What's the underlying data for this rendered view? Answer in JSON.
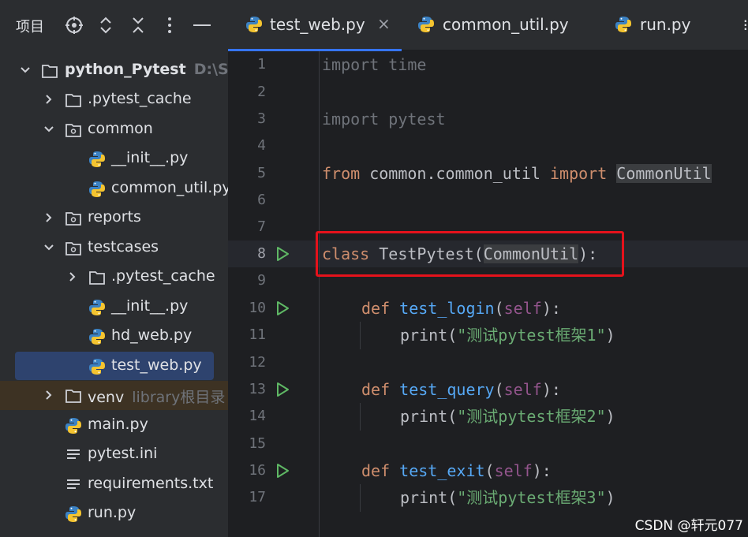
{
  "project_panel": {
    "title": "项目",
    "tree": [
      {
        "label": "python_Pytest",
        "hint": "D:\\Sof",
        "type": "root-folder",
        "expanded": true
      },
      {
        "label": ".pytest_cache",
        "type": "folder",
        "expanded": false
      },
      {
        "label": "common",
        "type": "package",
        "expanded": true
      },
      {
        "label": "__init__.py",
        "type": "python-file"
      },
      {
        "label": "common_util.py",
        "type": "python-file"
      },
      {
        "label": "reports",
        "type": "package",
        "expanded": false
      },
      {
        "label": "testcases",
        "type": "package",
        "expanded": true
      },
      {
        "label": ".pytest_cache",
        "type": "folder",
        "expanded": false
      },
      {
        "label": "__init__.py",
        "type": "python-file"
      },
      {
        "label": "hd_web.py",
        "type": "python-file"
      },
      {
        "label": "test_web.py",
        "type": "python-file",
        "selected": true
      },
      {
        "label": "venv",
        "hint": "library根目录",
        "type": "folder",
        "expanded": false
      },
      {
        "label": "main.py",
        "type": "python-file"
      },
      {
        "label": "pytest.ini",
        "type": "text-file"
      },
      {
        "label": "requirements.txt",
        "type": "text-file"
      },
      {
        "label": "run.py",
        "type": "python-file"
      }
    ]
  },
  "tabs": [
    {
      "label": "test_web.py",
      "active": true,
      "close": "×"
    },
    {
      "label": "common_util.py",
      "active": false
    },
    {
      "label": "run.py",
      "active": false
    }
  ],
  "tab_menu_glyph": "⁝",
  "editor": {
    "line_numbers": [
      "1",
      "2",
      "3",
      "4",
      "5",
      "6",
      "7",
      "8",
      "9",
      "10",
      "11",
      "12",
      "13",
      "14",
      "15",
      "16",
      "17"
    ],
    "active_line": "8",
    "lines": {
      "l1_kw": "import",
      "l1_rest": " time",
      "l3_kw": "import",
      "l3_rest": " pytest",
      "l5_kw1": "from",
      "l5_mod": " common.common_util ",
      "l5_kw2": "import",
      "l5_sp": " ",
      "l5_cls": "CommonUtil",
      "l8_kw": "class",
      "l8_name": " TestPytest(",
      "l8_base": "CommonUtil",
      "l8_end": "):",
      "l10_kw": "def",
      "l10_fn": "test_login",
      "l10_self": "self",
      "l11_print": "print",
      "l11_str": "\"测试pytest框架1\"",
      "l13_kw": "def",
      "l13_fn": "test_query",
      "l13_self": "self",
      "l14_print": "print",
      "l14_str": "\"测试pytest框架2\"",
      "l16_kw": "def",
      "l16_fn": "test_exit",
      "l16_self": "self",
      "l17_print": "print",
      "l17_str": "\"测试pytest框架3\""
    }
  },
  "watermark": "CSDN @轩元077",
  "colors": {
    "keyword": "#cf8e6d",
    "function": "#56a8f5",
    "self": "#94558d",
    "string": "#6aab73",
    "highlight_box": "#e5121b",
    "selection": "#2e436e",
    "accent": "#3574f0"
  }
}
